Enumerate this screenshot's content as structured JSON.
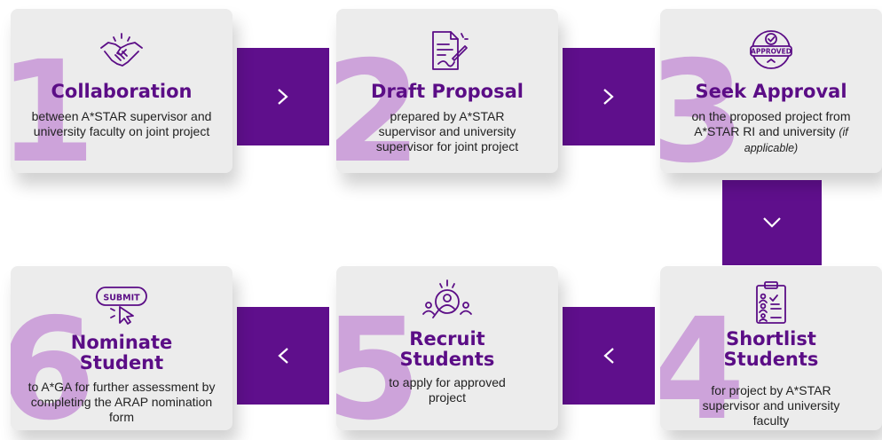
{
  "steps": [
    {
      "number": "1",
      "title": "Collaboration",
      "desc": "between A*STAR supervisor and university faculty on joint project",
      "icon": "handshake-icon"
    },
    {
      "number": "2",
      "title": "Draft Proposal",
      "desc": "prepared by A*STAR supervisor and university supervisor for joint project",
      "icon": "document-pen-icon"
    },
    {
      "number": "3",
      "title": "Seek Approval",
      "desc": "on the proposed project from A*STAR RI and university",
      "desc_note": "(if applicable)",
      "icon": "approved-badge-icon",
      "badge_text": "APPROVED"
    },
    {
      "number": "4",
      "title_line1": "Shortlist",
      "title_line2": "Students",
      "desc": "for project by A*STAR supervisor and university faculty",
      "icon": "clipboard-checklist-icon"
    },
    {
      "number": "5",
      "title_line1": "Recruit",
      "title_line2": "Students",
      "desc": "to apply for approved project",
      "icon": "search-people-icon"
    },
    {
      "number": "6",
      "title_line1": "Nominate",
      "title_line2": "Student",
      "desc": "to A*GA for further assessment by completing the ARAP nomination form",
      "icon": "submit-click-icon",
      "badge_text": "SUBMIT"
    }
  ],
  "connectors": [
    {
      "name": "arrow-1-to-2",
      "direction": "right"
    },
    {
      "name": "arrow-2-to-3",
      "direction": "right"
    },
    {
      "name": "arrow-3-to-4",
      "direction": "down"
    },
    {
      "name": "arrow-4-to-5",
      "direction": "left"
    },
    {
      "name": "arrow-5-to-6",
      "direction": "left"
    }
  ],
  "colors": {
    "accent": "#5f0f8c",
    "title": "#5b0d86",
    "number": "#cda3da",
    "card": "#ececec"
  }
}
